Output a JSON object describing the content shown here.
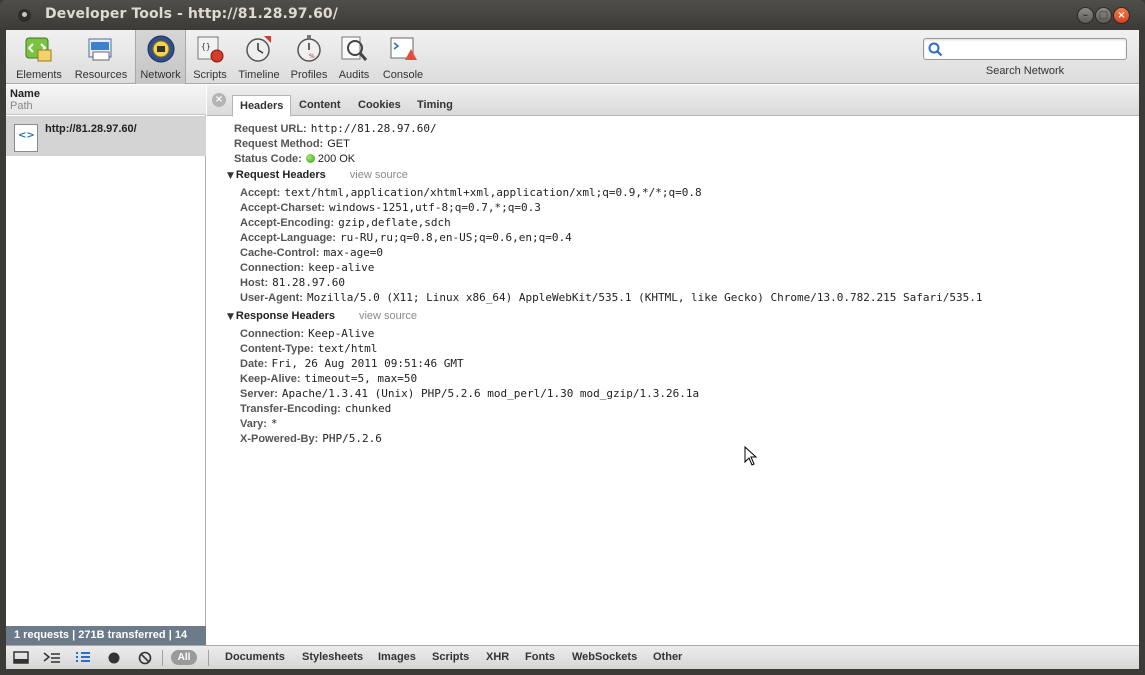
{
  "window": {
    "title": "Developer Tools - http://81.28.97.60/"
  },
  "toolbar": {
    "items": [
      {
        "label": "Elements",
        "icon": "elements-icon"
      },
      {
        "label": "Resources",
        "icon": "resources-icon"
      },
      {
        "label": "Network",
        "icon": "network-icon",
        "active": true
      },
      {
        "label": "Scripts",
        "icon": "scripts-icon"
      },
      {
        "label": "Timeline",
        "icon": "timeline-icon"
      },
      {
        "label": "Profiles",
        "icon": "profiles-icon"
      },
      {
        "label": "Audits",
        "icon": "audits-icon"
      },
      {
        "label": "Console",
        "icon": "console-icon"
      }
    ],
    "search": {
      "value": "",
      "label": "Search Network"
    }
  },
  "sidebar": {
    "header_name": "Name",
    "header_path": "Path",
    "request": {
      "name": "http://81.28.97.60/"
    },
    "status": "1 requests  |  271B transferred  |  14"
  },
  "detail": {
    "tabs": [
      {
        "label": "Headers",
        "active": true
      },
      {
        "label": "Content"
      },
      {
        "label": "Cookies"
      },
      {
        "label": "Timing"
      }
    ],
    "general": [
      {
        "key": "Request URL:",
        "value": "http://81.28.97.60/"
      },
      {
        "key": "Request Method:",
        "value": "GET"
      },
      {
        "key": "Status Code:",
        "value": "200 OK"
      }
    ],
    "request_headers_title": "Request Headers",
    "response_headers_title": "Response Headers",
    "view_source": "view source",
    "request_headers": [
      {
        "key": "Accept:",
        "value": "text/html,application/xhtml+xml,application/xml;q=0.9,*/*;q=0.8"
      },
      {
        "key": "Accept-Charset:",
        "value": "windows-1251,utf-8;q=0.7,*;q=0.3"
      },
      {
        "key": "Accept-Encoding:",
        "value": "gzip,deflate,sdch"
      },
      {
        "key": "Accept-Language:",
        "value": "ru-RU,ru;q=0.8,en-US;q=0.6,en;q=0.4"
      },
      {
        "key": "Cache-Control:",
        "value": "max-age=0"
      },
      {
        "key": "Connection:",
        "value": "keep-alive"
      },
      {
        "key": "Host:",
        "value": "81.28.97.60"
      },
      {
        "key": "User-Agent:",
        "value": "Mozilla/5.0 (X11; Linux x86_64) AppleWebKit/535.1 (KHTML, like Gecko) Chrome/13.0.782.215 Safari/535.1"
      }
    ],
    "response_headers": [
      {
        "key": "Connection:",
        "value": "Keep-Alive"
      },
      {
        "key": "Content-Type:",
        "value": "text/html"
      },
      {
        "key": "Date:",
        "value": "Fri, 26 Aug 2011 09:51:46 GMT"
      },
      {
        "key": "Keep-Alive:",
        "value": "timeout=5, max=50"
      },
      {
        "key": "Server:",
        "value": "Apache/1.3.41 (Unix) PHP/5.2.6 mod_perl/1.30 mod_gzip/1.3.26.1a"
      },
      {
        "key": "Transfer-Encoding:",
        "value": "chunked"
      },
      {
        "key": "Vary:",
        "value": "*"
      },
      {
        "key": "X-Powered-By:",
        "value": "PHP/5.2.6"
      }
    ]
  },
  "bottom": {
    "all_label": "All",
    "filters": [
      "Documents",
      "Stylesheets",
      "Images",
      "Scripts",
      "XHR",
      "Fonts",
      "WebSockets",
      "Other"
    ]
  }
}
